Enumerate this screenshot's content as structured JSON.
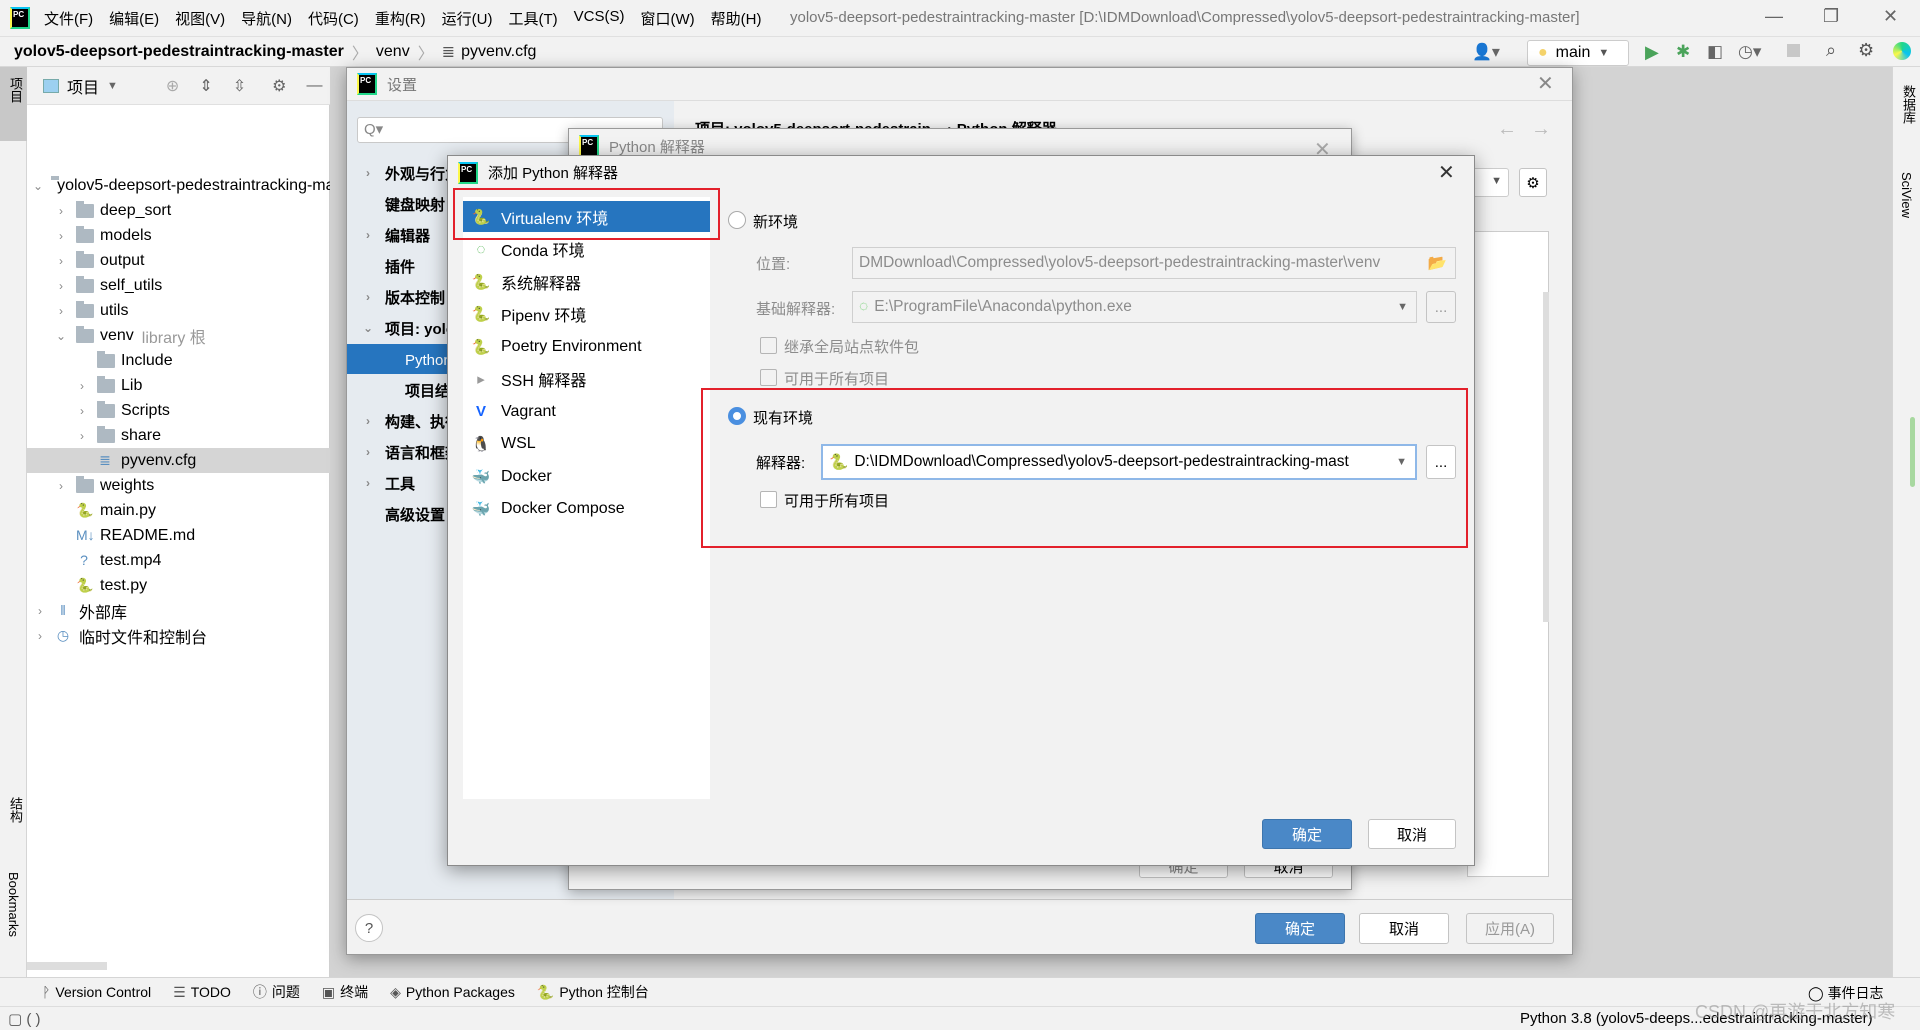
{
  "menubar": {
    "items": [
      "文件(F)",
      "编辑(E)",
      "视图(V)",
      "导航(N)",
      "代码(C)",
      "重构(R)",
      "运行(U)",
      "工具(T)",
      "VCS(S)",
      "窗口(W)",
      "帮助(H)"
    ],
    "window_title": "yolov5-deepsort-pedestraintracking-master [D:\\IDMDownload\\Compressed\\yolov5-deepsort-pedestraintracking-master]"
  },
  "breadcrumb": [
    "yolov5-deepsort-pedestraintracking-master",
    "venv",
    "pyvenv.cfg"
  ],
  "toolbar": {
    "run_config": "main"
  },
  "left_strip": {
    "project": "项目",
    "structure": "结构",
    "bookmarks": "Bookmarks"
  },
  "right_strip": {
    "database": "数据库",
    "sciview": "SciView"
  },
  "project_panel": {
    "title": "项目",
    "tree": [
      {
        "label": "yolov5-deepsort-pedestraintracking-master",
        "depth": 0,
        "chev": "down",
        "icon": "folder"
      },
      {
        "label": "deep_sort",
        "depth": 1,
        "chev": "right",
        "icon": "folder"
      },
      {
        "label": "models",
        "depth": 1,
        "chev": "right",
        "icon": "folder"
      },
      {
        "label": "output",
        "depth": 1,
        "chev": "right",
        "icon": "folder"
      },
      {
        "label": "self_utils",
        "depth": 1,
        "chev": "right",
        "icon": "folder"
      },
      {
        "label": "utils",
        "depth": 1,
        "chev": "right",
        "icon": "folder"
      },
      {
        "label": "venv",
        "hint": "library 根",
        "depth": 1,
        "chev": "down",
        "icon": "folder"
      },
      {
        "label": "Include",
        "depth": 2,
        "chev": "",
        "icon": "folder"
      },
      {
        "label": "Lib",
        "depth": 2,
        "chev": "right",
        "icon": "folder"
      },
      {
        "label": "Scripts",
        "depth": 2,
        "chev": "right",
        "icon": "folder"
      },
      {
        "label": "share",
        "depth": 2,
        "chev": "right",
        "icon": "folder"
      },
      {
        "label": "pyvenv.cfg",
        "depth": 2,
        "chev": "",
        "icon": "config-file",
        "selected": true
      },
      {
        "label": "weights",
        "depth": 1,
        "chev": "right",
        "icon": "folder"
      },
      {
        "label": "main.py",
        "depth": 1,
        "chev": "",
        "icon": "python-file"
      },
      {
        "label": "README.md",
        "depth": 1,
        "chev": "",
        "icon": "markdown-file"
      },
      {
        "label": "test.mp4",
        "depth": 1,
        "chev": "",
        "icon": "unknown-file"
      },
      {
        "label": "test.py",
        "depth": 1,
        "chev": "",
        "icon": "python-file"
      },
      {
        "label": "外部库",
        "depth": 0,
        "chev": "right",
        "icon": "library"
      },
      {
        "label": "临时文件和控制台",
        "depth": 0,
        "chev": "right",
        "icon": "scratch"
      }
    ]
  },
  "settings": {
    "title": "设置",
    "search_placeholder": "Q▾",
    "nav": [
      {
        "label": "外观与行为",
        "chev": "right"
      },
      {
        "label": "键盘映射",
        "chev": ""
      },
      {
        "label": "编辑器",
        "chev": "right"
      },
      {
        "label": "插件",
        "chev": ""
      },
      {
        "label": "版本控制",
        "chev": "right"
      },
      {
        "label": "项目: yolov5",
        "chev": "down"
      },
      {
        "label": "Python 解释器",
        "chev": "",
        "selected": true,
        "sub": true
      },
      {
        "label": "项目结构",
        "chev": "",
        "sub": true
      },
      {
        "label": "构建、执行",
        "chev": "right"
      },
      {
        "label": "语言和框架",
        "chev": "right"
      },
      {
        "label": "工具",
        "chev": "right"
      },
      {
        "label": "高级设置",
        "chev": ""
      }
    ],
    "breadcrumb": "项目: yolov5-deepsort-pedestrain... › Python 解释器",
    "ok": "确定",
    "cancel": "取消",
    "apply": "应用(A)",
    "help": "?"
  },
  "python_interpreter_dialog": {
    "title": "Python 解释器",
    "ok": "确定",
    "cancel": "取消"
  },
  "add_dialog": {
    "title": "添加 Python 解释器",
    "types": [
      {
        "label": "Virtualenv 环境",
        "icon": "virtualenv-icon",
        "selected": true
      },
      {
        "label": "Conda 环境",
        "icon": "conda-icon"
      },
      {
        "label": "系统解释器",
        "icon": "python-icon"
      },
      {
        "label": "Pipenv 环境",
        "icon": "pipenv-icon"
      },
      {
        "label": "Poetry Environment",
        "icon": "poetry-icon"
      },
      {
        "label": "SSH 解释器",
        "icon": "ssh-icon"
      },
      {
        "label": "Vagrant",
        "icon": "vagrant-icon"
      },
      {
        "label": "WSL",
        "icon": "linux-icon"
      },
      {
        "label": "Docker",
        "icon": "docker-icon"
      },
      {
        "label": "Docker Compose",
        "icon": "docker-icon"
      }
    ],
    "new_env": {
      "label": "新环境",
      "selected": false,
      "location_label": "位置:",
      "location_value": "DMDownload\\Compressed\\yolov5-deepsort-pedestraintracking-master\\venv",
      "base_label": "基础解释器:",
      "base_value": "E:\\ProgramFile\\Anaconda\\python.exe",
      "inherit_label": "继承全局站点软件包",
      "inherit_checked": false,
      "all_projects_label": "可用于所有项目",
      "all_projects_checked": false
    },
    "existing_env": {
      "label": "现有环境",
      "selected": true,
      "interpreter_label": "解释器:",
      "interpreter_value": "D:\\IDMDownload\\Compressed\\yolov5-deepsort-pedestraintracking-mast",
      "all_projects_label": "可用于所有项目",
      "all_projects_checked": false
    },
    "browse": "...",
    "ok": "确定",
    "cancel": "取消"
  },
  "toolwindows": [
    "Version Control",
    "TODO",
    "问题",
    "终端",
    "Python Packages",
    "Python 控制台"
  ],
  "event_log": "事件日志",
  "status": {
    "interpreter": "Python 3.8 (yolov5-deeps...edestraintracking-master)"
  },
  "watermark": "CSDN @再游于北方知寒",
  "colors": {
    "accent": "#2675bf",
    "highlight_box": "#e3202b",
    "primary_button": "#4a88c7"
  }
}
